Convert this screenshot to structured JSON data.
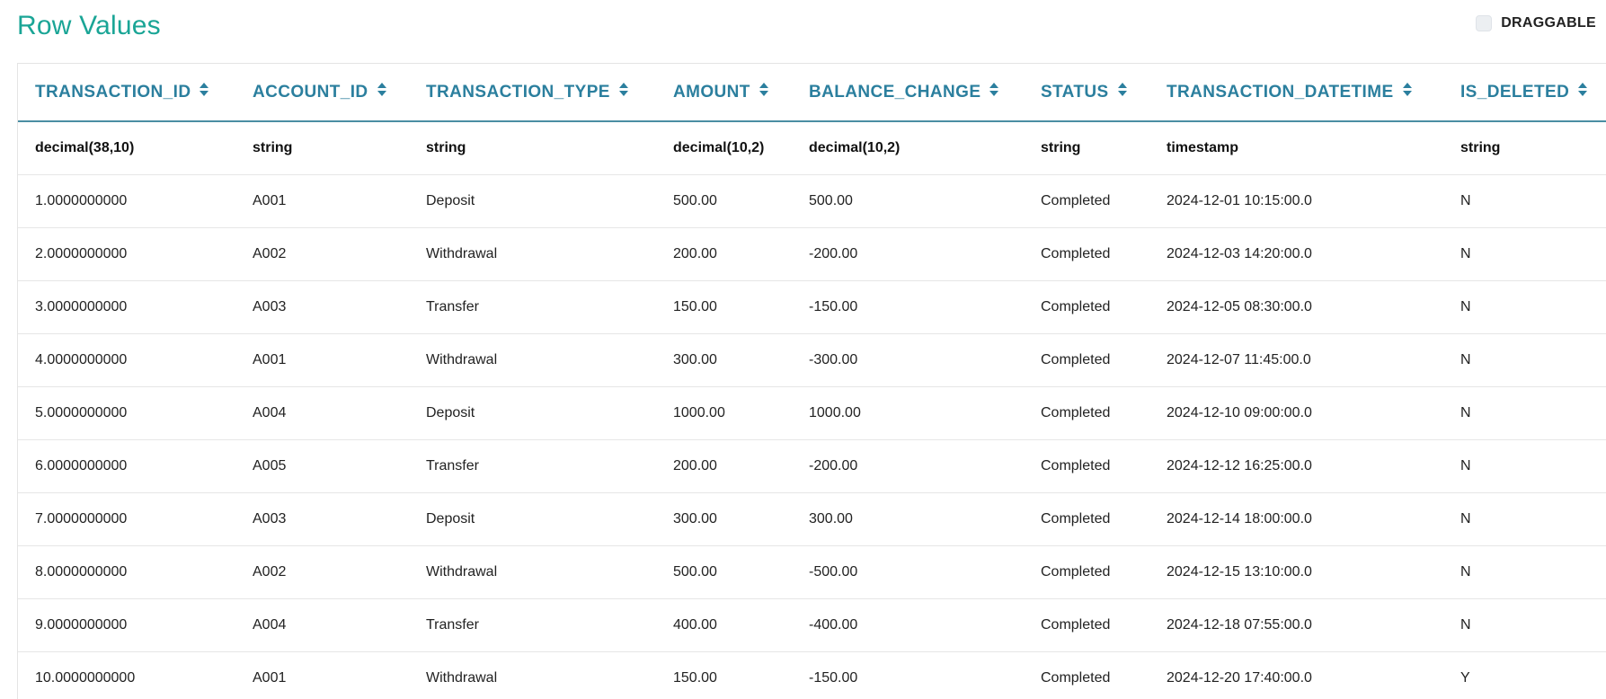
{
  "title": "Row Values",
  "draggable_label": "DRAGGABLE",
  "columns": [
    "TRANSACTION_ID",
    "ACCOUNT_ID",
    "TRANSACTION_TYPE",
    "AMOUNT",
    "BALANCE_CHANGE",
    "STATUS",
    "TRANSACTION_DATETIME",
    "IS_DELETED"
  ],
  "types": [
    "decimal(38,10)",
    "string",
    "string",
    "decimal(10,2)",
    "decimal(10,2)",
    "string",
    "timestamp",
    "string"
  ],
  "rows": [
    [
      "1.0000000000",
      "A001",
      "Deposit",
      "500.00",
      "500.00",
      "Completed",
      "2024-12-01 10:15:00.0",
      "N"
    ],
    [
      "2.0000000000",
      "A002",
      "Withdrawal",
      "200.00",
      "-200.00",
      "Completed",
      "2024-12-03 14:20:00.0",
      "N"
    ],
    [
      "3.0000000000",
      "A003",
      "Transfer",
      "150.00",
      "-150.00",
      "Completed",
      "2024-12-05 08:30:00.0",
      "N"
    ],
    [
      "4.0000000000",
      "A001",
      "Withdrawal",
      "300.00",
      "-300.00",
      "Completed",
      "2024-12-07 11:45:00.0",
      "N"
    ],
    [
      "5.0000000000",
      "A004",
      "Deposit",
      "1000.00",
      "1000.00",
      "Completed",
      "2024-12-10 09:00:00.0",
      "N"
    ],
    [
      "6.0000000000",
      "A005",
      "Transfer",
      "200.00",
      "-200.00",
      "Completed",
      "2024-12-12 16:25:00.0",
      "N"
    ],
    [
      "7.0000000000",
      "A003",
      "Deposit",
      "300.00",
      "300.00",
      "Completed",
      "2024-12-14 18:00:00.0",
      "N"
    ],
    [
      "8.0000000000",
      "A002",
      "Withdrawal",
      "500.00",
      "-500.00",
      "Completed",
      "2024-12-15 13:10:00.0",
      "N"
    ],
    [
      "9.0000000000",
      "A004",
      "Transfer",
      "400.00",
      "-400.00",
      "Completed",
      "2024-12-18 07:55:00.0",
      "N"
    ],
    [
      "10.0000000000",
      "A001",
      "Withdrawal",
      "150.00",
      "-150.00",
      "Completed",
      "2024-12-20 17:40:00.0",
      "Y"
    ]
  ],
  "colors": {
    "title": "#1aa596",
    "header": "#2b7f9e"
  }
}
